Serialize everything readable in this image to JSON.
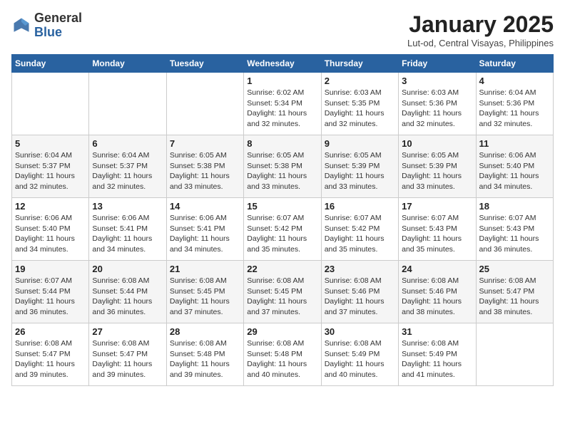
{
  "header": {
    "logo_general": "General",
    "logo_blue": "Blue",
    "month_title": "January 2025",
    "subtitle": "Lut-od, Central Visayas, Philippines"
  },
  "days_of_week": [
    "Sunday",
    "Monday",
    "Tuesday",
    "Wednesday",
    "Thursday",
    "Friday",
    "Saturday"
  ],
  "weeks": [
    [
      {
        "day": "",
        "info": ""
      },
      {
        "day": "",
        "info": ""
      },
      {
        "day": "",
        "info": ""
      },
      {
        "day": "1",
        "info": "Sunrise: 6:02 AM\nSunset: 5:34 PM\nDaylight: 11 hours\nand 32 minutes."
      },
      {
        "day": "2",
        "info": "Sunrise: 6:03 AM\nSunset: 5:35 PM\nDaylight: 11 hours\nand 32 minutes."
      },
      {
        "day": "3",
        "info": "Sunrise: 6:03 AM\nSunset: 5:36 PM\nDaylight: 11 hours\nand 32 minutes."
      },
      {
        "day": "4",
        "info": "Sunrise: 6:04 AM\nSunset: 5:36 PM\nDaylight: 11 hours\nand 32 minutes."
      }
    ],
    [
      {
        "day": "5",
        "info": "Sunrise: 6:04 AM\nSunset: 5:37 PM\nDaylight: 11 hours\nand 32 minutes."
      },
      {
        "day": "6",
        "info": "Sunrise: 6:04 AM\nSunset: 5:37 PM\nDaylight: 11 hours\nand 32 minutes."
      },
      {
        "day": "7",
        "info": "Sunrise: 6:05 AM\nSunset: 5:38 PM\nDaylight: 11 hours\nand 33 minutes."
      },
      {
        "day": "8",
        "info": "Sunrise: 6:05 AM\nSunset: 5:38 PM\nDaylight: 11 hours\nand 33 minutes."
      },
      {
        "day": "9",
        "info": "Sunrise: 6:05 AM\nSunset: 5:39 PM\nDaylight: 11 hours\nand 33 minutes."
      },
      {
        "day": "10",
        "info": "Sunrise: 6:05 AM\nSunset: 5:39 PM\nDaylight: 11 hours\nand 33 minutes."
      },
      {
        "day": "11",
        "info": "Sunrise: 6:06 AM\nSunset: 5:40 PM\nDaylight: 11 hours\nand 34 minutes."
      }
    ],
    [
      {
        "day": "12",
        "info": "Sunrise: 6:06 AM\nSunset: 5:40 PM\nDaylight: 11 hours\nand 34 minutes."
      },
      {
        "day": "13",
        "info": "Sunrise: 6:06 AM\nSunset: 5:41 PM\nDaylight: 11 hours\nand 34 minutes."
      },
      {
        "day": "14",
        "info": "Sunrise: 6:06 AM\nSunset: 5:41 PM\nDaylight: 11 hours\nand 34 minutes."
      },
      {
        "day": "15",
        "info": "Sunrise: 6:07 AM\nSunset: 5:42 PM\nDaylight: 11 hours\nand 35 minutes."
      },
      {
        "day": "16",
        "info": "Sunrise: 6:07 AM\nSunset: 5:42 PM\nDaylight: 11 hours\nand 35 minutes."
      },
      {
        "day": "17",
        "info": "Sunrise: 6:07 AM\nSunset: 5:43 PM\nDaylight: 11 hours\nand 35 minutes."
      },
      {
        "day": "18",
        "info": "Sunrise: 6:07 AM\nSunset: 5:43 PM\nDaylight: 11 hours\nand 36 minutes."
      }
    ],
    [
      {
        "day": "19",
        "info": "Sunrise: 6:07 AM\nSunset: 5:44 PM\nDaylight: 11 hours\nand 36 minutes."
      },
      {
        "day": "20",
        "info": "Sunrise: 6:08 AM\nSunset: 5:44 PM\nDaylight: 11 hours\nand 36 minutes."
      },
      {
        "day": "21",
        "info": "Sunrise: 6:08 AM\nSunset: 5:45 PM\nDaylight: 11 hours\nand 37 minutes."
      },
      {
        "day": "22",
        "info": "Sunrise: 6:08 AM\nSunset: 5:45 PM\nDaylight: 11 hours\nand 37 minutes."
      },
      {
        "day": "23",
        "info": "Sunrise: 6:08 AM\nSunset: 5:46 PM\nDaylight: 11 hours\nand 37 minutes."
      },
      {
        "day": "24",
        "info": "Sunrise: 6:08 AM\nSunset: 5:46 PM\nDaylight: 11 hours\nand 38 minutes."
      },
      {
        "day": "25",
        "info": "Sunrise: 6:08 AM\nSunset: 5:47 PM\nDaylight: 11 hours\nand 38 minutes."
      }
    ],
    [
      {
        "day": "26",
        "info": "Sunrise: 6:08 AM\nSunset: 5:47 PM\nDaylight: 11 hours\nand 39 minutes."
      },
      {
        "day": "27",
        "info": "Sunrise: 6:08 AM\nSunset: 5:47 PM\nDaylight: 11 hours\nand 39 minutes."
      },
      {
        "day": "28",
        "info": "Sunrise: 6:08 AM\nSunset: 5:48 PM\nDaylight: 11 hours\nand 39 minutes."
      },
      {
        "day": "29",
        "info": "Sunrise: 6:08 AM\nSunset: 5:48 PM\nDaylight: 11 hours\nand 40 minutes."
      },
      {
        "day": "30",
        "info": "Sunrise: 6:08 AM\nSunset: 5:49 PM\nDaylight: 11 hours\nand 40 minutes."
      },
      {
        "day": "31",
        "info": "Sunrise: 6:08 AM\nSunset: 5:49 PM\nDaylight: 11 hours\nand 41 minutes."
      },
      {
        "day": "",
        "info": ""
      }
    ]
  ]
}
